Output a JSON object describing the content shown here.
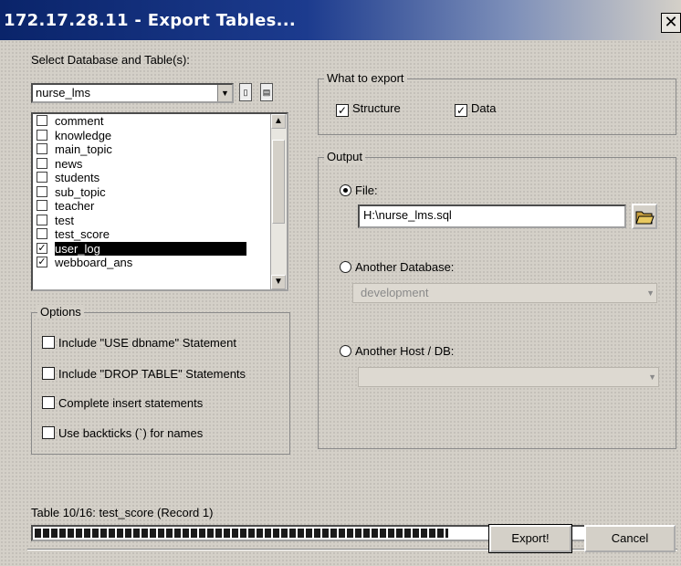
{
  "window": {
    "title": "172.17.28.11 - Export Tables..."
  },
  "select_db_label": "Select Database and Table(s):",
  "database": {
    "selected": "nurse_lms"
  },
  "tables": [
    {
      "name": "comment",
      "checked": false
    },
    {
      "name": "knowledge",
      "checked": false
    },
    {
      "name": "main_topic",
      "checked": false
    },
    {
      "name": "news",
      "checked": false
    },
    {
      "name": "students",
      "checked": false
    },
    {
      "name": "sub_topic",
      "checked": false
    },
    {
      "name": "teacher",
      "checked": false
    },
    {
      "name": "test",
      "checked": false
    },
    {
      "name": "test_score",
      "checked": false
    },
    {
      "name": "user_log",
      "checked": true,
      "selected": true
    },
    {
      "name": "webboard_ans",
      "checked": true
    }
  ],
  "options": {
    "title": "Options",
    "items": [
      "Include \"USE dbname\" Statement",
      "Include \"DROP TABLE\" Statements",
      "Complete insert statements",
      "Use backticks (`) for names"
    ]
  },
  "what_to_export": {
    "title": "What to export",
    "structure_label": "Structure",
    "data_label": "Data",
    "structure_checked": true,
    "data_checked": true
  },
  "output": {
    "title": "Output",
    "file_label": "File:",
    "file_path": "H:\\nurse_lms.sql",
    "another_db_label": "Another Database:",
    "another_db_value": "development",
    "another_host_label": "Another Host / DB:",
    "another_host_value": "",
    "selected": "file"
  },
  "status": {
    "text": "Table 10/16: test_score (Record 1)",
    "progress": 0.65
  },
  "buttons": {
    "export": "Export!",
    "cancel": "Cancel"
  },
  "icons": {
    "close": "close-icon",
    "select_all": "select-all-icon",
    "select_none": "select-none-icon",
    "folder": "folder-open-icon"
  }
}
